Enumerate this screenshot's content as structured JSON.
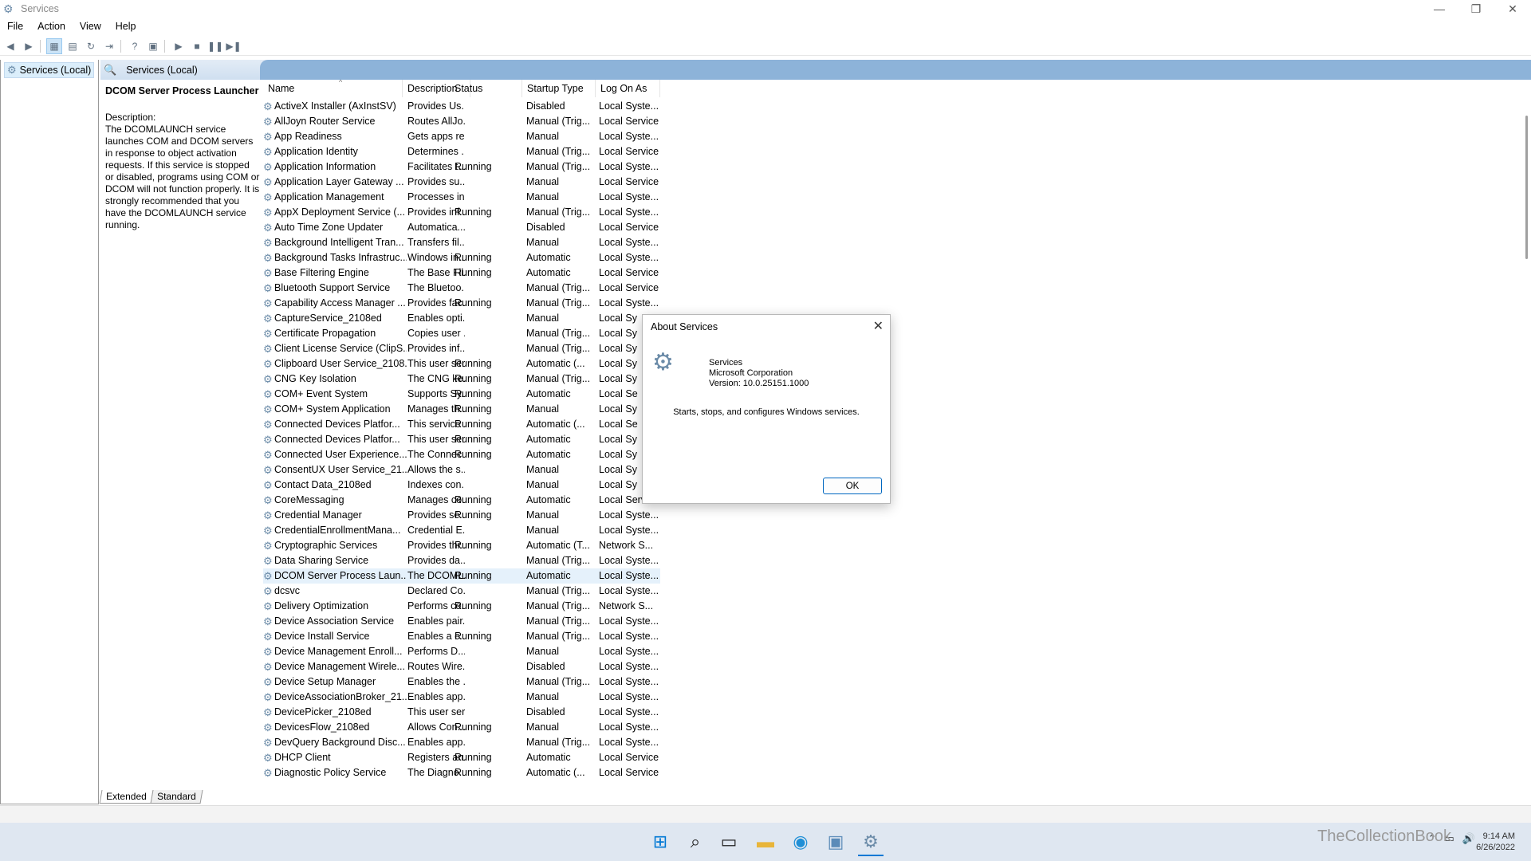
{
  "window": {
    "title": "Services"
  },
  "menu": [
    "File",
    "Action",
    "View",
    "Help"
  ],
  "tree": {
    "root_label": "Services (Local)"
  },
  "header": {
    "title": "Services (Local)"
  },
  "description_pane": {
    "service_name": "DCOM Server Process Launcher",
    "label": "Description:",
    "text": "The DCOMLAUNCH service launches COM and DCOM servers in response to object activation requests. If this service is stopped or disabled, programs using COM or DCOM will not function properly. It is strongly recommended that you have the DCOMLAUNCH service running."
  },
  "columns": [
    "Name",
    "Description",
    "Status",
    "Startup Type",
    "Log On As"
  ],
  "services": [
    [
      "ActiveX Installer (AxInstSV)",
      "Provides Us...",
      "",
      "Disabled",
      "Local Syste..."
    ],
    [
      "AllJoyn Router Service",
      "Routes AllJo...",
      "",
      "Manual (Trig...",
      "Local Service"
    ],
    [
      "App Readiness",
      "Gets apps re...",
      "",
      "Manual",
      "Local Syste..."
    ],
    [
      "Application Identity",
      "Determines ...",
      "",
      "Manual (Trig...",
      "Local Service"
    ],
    [
      "Application Information",
      "Facilitates t...",
      "Running",
      "Manual (Trig...",
      "Local Syste..."
    ],
    [
      "Application Layer Gateway ...",
      "Provides su...",
      "",
      "Manual",
      "Local Service"
    ],
    [
      "Application Management",
      "Processes in...",
      "",
      "Manual",
      "Local Syste..."
    ],
    [
      "AppX Deployment Service (...",
      "Provides inf...",
      "Running",
      "Manual (Trig...",
      "Local Syste..."
    ],
    [
      "Auto Time Zone Updater",
      "Automatica...",
      "",
      "Disabled",
      "Local Service"
    ],
    [
      "Background Intelligent Tran...",
      "Transfers fil...",
      "",
      "Manual",
      "Local Syste..."
    ],
    [
      "Background Tasks Infrastruc...",
      "Windows in...",
      "Running",
      "Automatic",
      "Local Syste..."
    ],
    [
      "Base Filtering Engine",
      "The Base Fil...",
      "Running",
      "Automatic",
      "Local Service"
    ],
    [
      "Bluetooth Support Service",
      "The Bluetoo...",
      "",
      "Manual (Trig...",
      "Local Service"
    ],
    [
      "Capability Access Manager ...",
      "Provides fac...",
      "Running",
      "Manual (Trig...",
      "Local Syste..."
    ],
    [
      "CaptureService_2108ed",
      "Enables opti...",
      "",
      "Manual",
      "Local Sy"
    ],
    [
      "Certificate Propagation",
      "Copies user ...",
      "",
      "Manual (Trig...",
      "Local Sy"
    ],
    [
      "Client License Service (ClipS...",
      "Provides inf...",
      "",
      "Manual (Trig...",
      "Local Sy"
    ],
    [
      "Clipboard User Service_2108...",
      "This user ser...",
      "Running",
      "Automatic (...",
      "Local Sy"
    ],
    [
      "CNG Key Isolation",
      "The CNG ke...",
      "Running",
      "Manual (Trig...",
      "Local Sy"
    ],
    [
      "COM+ Event System",
      "Supports Sy...",
      "Running",
      "Automatic",
      "Local Se"
    ],
    [
      "COM+ System Application",
      "Manages th...",
      "Running",
      "Manual",
      "Local Sy"
    ],
    [
      "Connected Devices Platfor...",
      "This service ...",
      "Running",
      "Automatic (...",
      "Local Se"
    ],
    [
      "Connected Devices Platfor...",
      "This user ser...",
      "Running",
      "Automatic",
      "Local Sy"
    ],
    [
      "Connected User Experience...",
      "The Connec...",
      "Running",
      "Automatic",
      "Local Sy"
    ],
    [
      "ConsentUX User Service_21...",
      "Allows the s...",
      "",
      "Manual",
      "Local Sy"
    ],
    [
      "Contact Data_2108ed",
      "Indexes con...",
      "",
      "Manual",
      "Local Sy"
    ],
    [
      "CoreMessaging",
      "Manages co...",
      "Running",
      "Automatic",
      "Local Service"
    ],
    [
      "Credential Manager",
      "Provides se...",
      "Running",
      "Manual",
      "Local Syste..."
    ],
    [
      "CredentialEnrollmentMana...",
      "Credential E...",
      "",
      "Manual",
      "Local Syste..."
    ],
    [
      "Cryptographic Services",
      "Provides thr...",
      "Running",
      "Automatic (T...",
      "Network S..."
    ],
    [
      "Data Sharing Service",
      "Provides da...",
      "",
      "Manual (Trig...",
      "Local Syste..."
    ],
    [
      "DCOM Server Process Laun...",
      "The DCOML...",
      "Running",
      "Automatic",
      "Local Syste..."
    ],
    [
      "dcsvc",
      "Declared Co...",
      "",
      "Manual (Trig...",
      "Local Syste..."
    ],
    [
      "Delivery Optimization",
      "Performs co...",
      "Running",
      "Manual (Trig...",
      "Network S..."
    ],
    [
      "Device Association Service",
      "Enables pair...",
      "",
      "Manual (Trig...",
      "Local Syste..."
    ],
    [
      "Device Install Service",
      "Enables a c...",
      "Running",
      "Manual (Trig...",
      "Local Syste..."
    ],
    [
      "Device Management Enroll...",
      "Performs D...",
      "",
      "Manual",
      "Local Syste..."
    ],
    [
      "Device Management Wirele...",
      "Routes Wire...",
      "",
      "Disabled",
      "Local Syste..."
    ],
    [
      "Device Setup Manager",
      "Enables the ...",
      "",
      "Manual (Trig...",
      "Local Syste..."
    ],
    [
      "DeviceAssociationBroker_21...",
      "Enables app...",
      "",
      "Manual",
      "Local Syste..."
    ],
    [
      "DevicePicker_2108ed",
      "This user ser...",
      "",
      "Disabled",
      "Local Syste..."
    ],
    [
      "DevicesFlow_2108ed",
      "Allows Con...",
      "Running",
      "Manual",
      "Local Syste..."
    ],
    [
      "DevQuery Background Disc...",
      "Enables app...",
      "",
      "Manual (Trig...",
      "Local Syste..."
    ],
    [
      "DHCP Client",
      "Registers an...",
      "Running",
      "Automatic",
      "Local Service"
    ],
    [
      "Diagnostic Policy Service",
      "The Diagno...",
      "Running",
      "Automatic (...",
      "Local Service"
    ]
  ],
  "selected_index": 31,
  "tabs": [
    "Extended",
    "Standard"
  ],
  "dialog": {
    "title": "About Services",
    "product": "Services",
    "company": "Microsoft Corporation",
    "version": "Version: 10.0.25151.1000",
    "message": "Starts, stops, and configures Windows services.",
    "ok_label": "OK"
  },
  "taskbar": {
    "time": "9:14 AM",
    "date": "6/26/2022",
    "watermark": "TheCollectionBook"
  }
}
